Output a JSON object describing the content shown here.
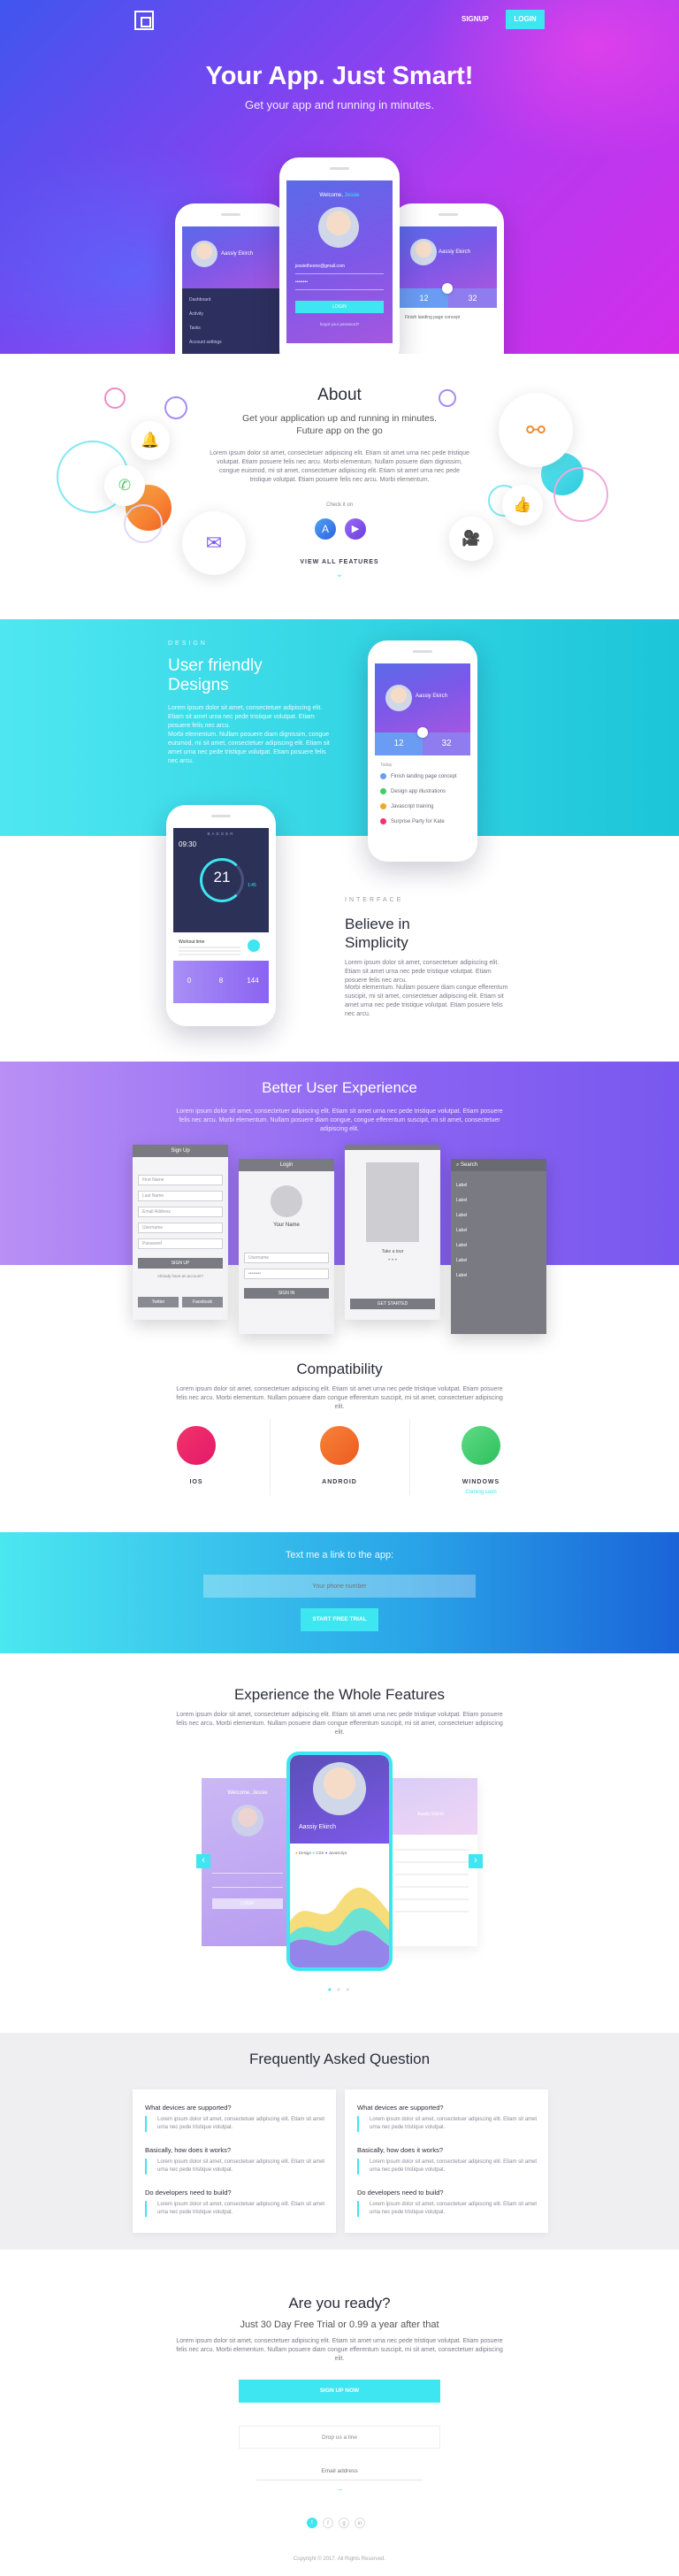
{
  "nav": {
    "signup": "SIGNUP",
    "login": "LOGIN",
    "logo_icon": "square-logo-icon"
  },
  "hero": {
    "title": "Your App. Just Smart!",
    "subtitle": "Get your app and running in minutes.",
    "phone_left": {
      "name": "Aassiy Ekirch",
      "menu": [
        "Dashboard",
        "Activity",
        "Tasks",
        "Account settings"
      ]
    },
    "phone_center": {
      "welcome": "Welcome",
      "username": "Jessie",
      "email": "jessietheone@gmail.com",
      "password": "••••••••",
      "button": "LOGIN",
      "link": "forgot your password?"
    },
    "phone_right": {
      "name": "Aassiy Ekirch",
      "stat1": "12",
      "stat2": "32",
      "item": "Finish landing page concept"
    }
  },
  "about": {
    "title": "About",
    "tagline_1": "Get your application up and running in minutes.",
    "tagline_2": "Future app on the go",
    "body": "Lorem ipsum dolor sit amet, consectetuer adipiscing elit. Etiam sit amet urna nec pede tristique volutpat. Etiam posuere felis nec arcu. Morbi elementum. Nullam posuere diam dignissim, congue euismod, mi sit amet, consectetuer adipiscing elit. Etiam sit amet urna nec pede tristique volutpat. Etiam posuere felis nec arcu. Morbi elementum.",
    "check_label": "Check it on",
    "view_all": "VIEW ALL FEATURES"
  },
  "design": {
    "eyebrow": "DESIGN",
    "title_1": "User friendly",
    "title_2": "Designs",
    "body_1": "Lorem ipsum dolor sit amet, consectetuer adipiscing elit. Etiam sit amet urna nec pede tristique volutpat. Etiam posuere felis nec arcu.",
    "body_2": "Morbi elementum. Nullam posuere diam dignissim, congue euismod, mi sit amet, consectetuer adipiscing elit. Etiam sit amet urna nec pede tristique volutpat. Etiam posuere felis nec arcu.",
    "phone": {
      "name": "Aassiy Ekirch",
      "stat1": "12",
      "stat2": "32",
      "today_label": "Today",
      "tasks": [
        "Finish landing page concept",
        "Design app illustrations",
        "Javascript training",
        "Surprise Party for Kate"
      ]
    }
  },
  "interface": {
    "eyebrow": "INTERFACE",
    "title_1": "Believe in",
    "title_2": "Simplicity",
    "body_1": "Lorem ipsum dolor sit amet, consectetuer adipiscing elit. Etiam sit amet urna nec pede tristique volutpat. Etiam posuere felis nec arcu.",
    "body_2": "Morbi elementum. Nullam posuere diam congue efferentum suscipit, mi sit amet, consectetuer adipiscing elit. Etiam sit amet urna nec pede tristique volutpat. Etiam posuere felis nec arcu.",
    "phone": {
      "brand": "BADGER",
      "time": "09:30",
      "big_number": "21",
      "small_number": "1:45",
      "task": "Workout time",
      "stats": [
        "0",
        "8",
        "144"
      ]
    }
  },
  "ux": {
    "title": "Better User Experience",
    "body": "Lorem ipsum dolor sit amet, consectetuer adipiscing elit. Etiam sit amet urna nec pede tristique volutpat. Etiam posuere felis nec arcu. Morbi elementum. Nullam posuere diam congue, congue efferentum suscipit, mi sit amet, consectetuer adipiscing elit.",
    "wire1": {
      "title": "Sign Up",
      "fields": [
        "First Name",
        "Last Name",
        "Email Address",
        "Username",
        "Password"
      ],
      "button": "SIGN UP",
      "link": "Already have an account?",
      "social": [
        "Twitter",
        "Facebook"
      ]
    },
    "wire2": {
      "title": "Login",
      "name": "Your Name",
      "fields": [
        "Username",
        "••••••••"
      ],
      "button": "SIGN IN"
    },
    "wire3": {
      "caption": "Take a tour",
      "button": "GET STARTED"
    },
    "wire4": {
      "title": "Search",
      "items": [
        "Label",
        "Label",
        "Label",
        "Label",
        "Label",
        "Label",
        "Label"
      ]
    }
  },
  "compat": {
    "title": "Compatibility",
    "body": "Lorem ipsum dolor sit amet, consectetuer adipiscing elit. Etiam sit amet urna nec pede tristique volutpat. Etiam posuere felis nec arcu. Morbi elementum. Nullam posuere diam congue efferentum suscipit, mi sit amet, consectetuer adipiscing elit.",
    "platforms": [
      {
        "label": "IOS",
        "note": ""
      },
      {
        "label": "ANDROID",
        "note": ""
      },
      {
        "label": "WINDOWS",
        "note": "Coming soon"
      }
    ],
    "colors": {
      "ios": "#f0346a",
      "android": "#f26a2a",
      "windows": "#3fcf6a"
    }
  },
  "sms": {
    "title": "Text me a link to the app:",
    "placeholder": "Your phone number",
    "button": "START FREE TRIAL"
  },
  "whole": {
    "title": "Experience the Whole Features",
    "body": "Lorem ipsum dolor sit amet, consectetuer adipiscing elit. Etiam sit amet urna nec pede tristique volutpat. Etiam posuere felis nec arcu. Morbi elementum. Nullam posuere diam congue efferentum suscipit, mi sit amet, consectetuer adipiscing elit.",
    "left_slide": {
      "welcome": "Welcome, Jessie",
      "button": "LOGIN"
    },
    "center_slide": {
      "name": "Aassiy Ekirch",
      "legend": [
        "Design",
        "CSS",
        "Javascript"
      ]
    },
    "right_slide": {
      "name": "Aassiy Ekirch"
    }
  },
  "faq": {
    "title": "Frequently Asked Question",
    "answer": "Lorem ipsum dolor sit amet, consectetuer adipiscing elit. Etiam sit amet urna nec pede tristique volutpat.",
    "questions": [
      "What devices are supported?",
      "Basically, how does it works?",
      "Do developers need to build?"
    ]
  },
  "ready": {
    "title": "Are you ready?",
    "subtitle": "Just 30 Day Free Trial or 0.99 a year after that",
    "body": "Lorem ipsum dolor sit amet, consectetuer adipiscing elit. Etiam sit amet urna nec pede tristique volutpat. Etiam posuere felis nec arcu. Morbi elementum. Nullam posuere diam congue efferentum suscipit, mi sit amet, consectetuer adipiscing elit.",
    "signup_button": "SIGN UP NOW",
    "secondary_button": "Drop us a line",
    "email_placeholder": "Email address",
    "social": [
      "twitter-icon",
      "facebook-icon",
      "google-icon",
      "linkedin-icon"
    ]
  },
  "footer": {
    "copyright": "Copyright © 2017. All Rights Reserved."
  },
  "colors": {
    "accent": "#3de6f0",
    "purple": "#8a63f2"
  }
}
